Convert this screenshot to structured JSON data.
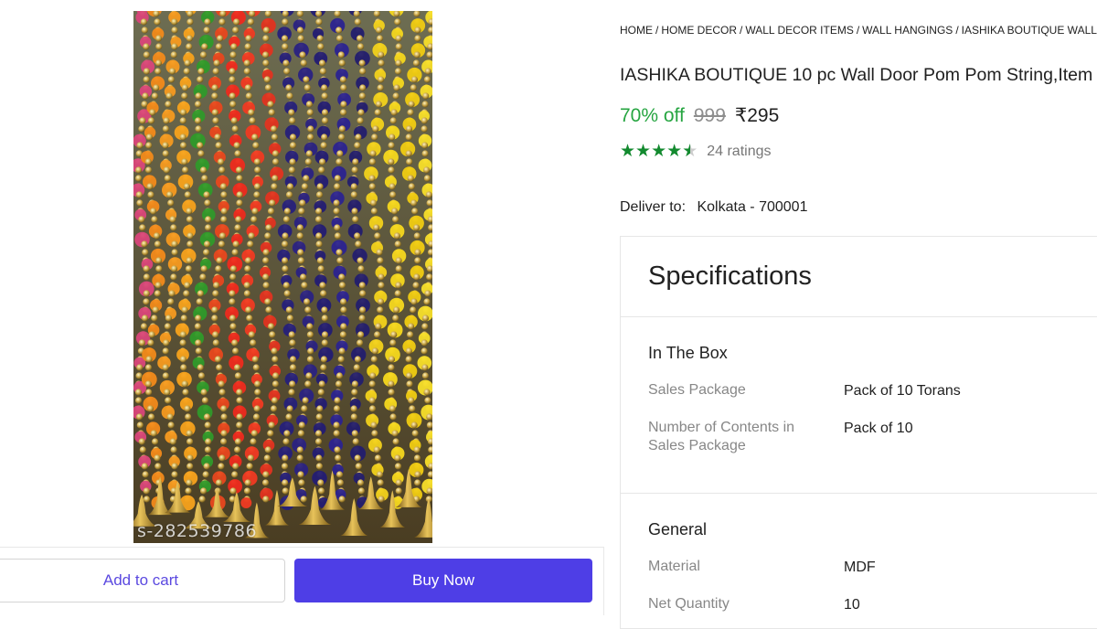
{
  "product_image": {
    "watermark": "s-282539786"
  },
  "actions": {
    "add_to_cart": "Add to cart",
    "buy_now": "Buy Now"
  },
  "breadcrumb": [
    "HOME",
    "HOME DECOR",
    "WALL DECOR ITEMS",
    "WALL HANGINGS",
    "IASHIKA BOUTIQUE WALL"
  ],
  "product": {
    "title": "IASHIKA BOUTIQUE 10 pc Wall Door Pom Pom String,Item",
    "discount": "70% off",
    "mrp": "999",
    "price": "₹295",
    "rating_stars": 4.5,
    "ratings_count": "24 ratings"
  },
  "delivery": {
    "label": "Deliver to:",
    "location": "Kolkata - 700001"
  },
  "specifications": {
    "title": "Specifications",
    "sections": [
      {
        "heading": "In The Box",
        "rows": [
          {
            "label": "Sales Package",
            "value": "Pack of 10 Torans"
          },
          {
            "label": "Number of Contents in Sales Package",
            "value": "Pack of 10"
          }
        ]
      },
      {
        "heading": "General",
        "rows": [
          {
            "label": "Material",
            "value": "MDF"
          },
          {
            "label": "Net Quantity",
            "value": "10"
          }
        ]
      }
    ]
  },
  "colors": {
    "accent": "#4e3ee6",
    "discount_green": "#26a541",
    "star_green": "#138a2f"
  }
}
